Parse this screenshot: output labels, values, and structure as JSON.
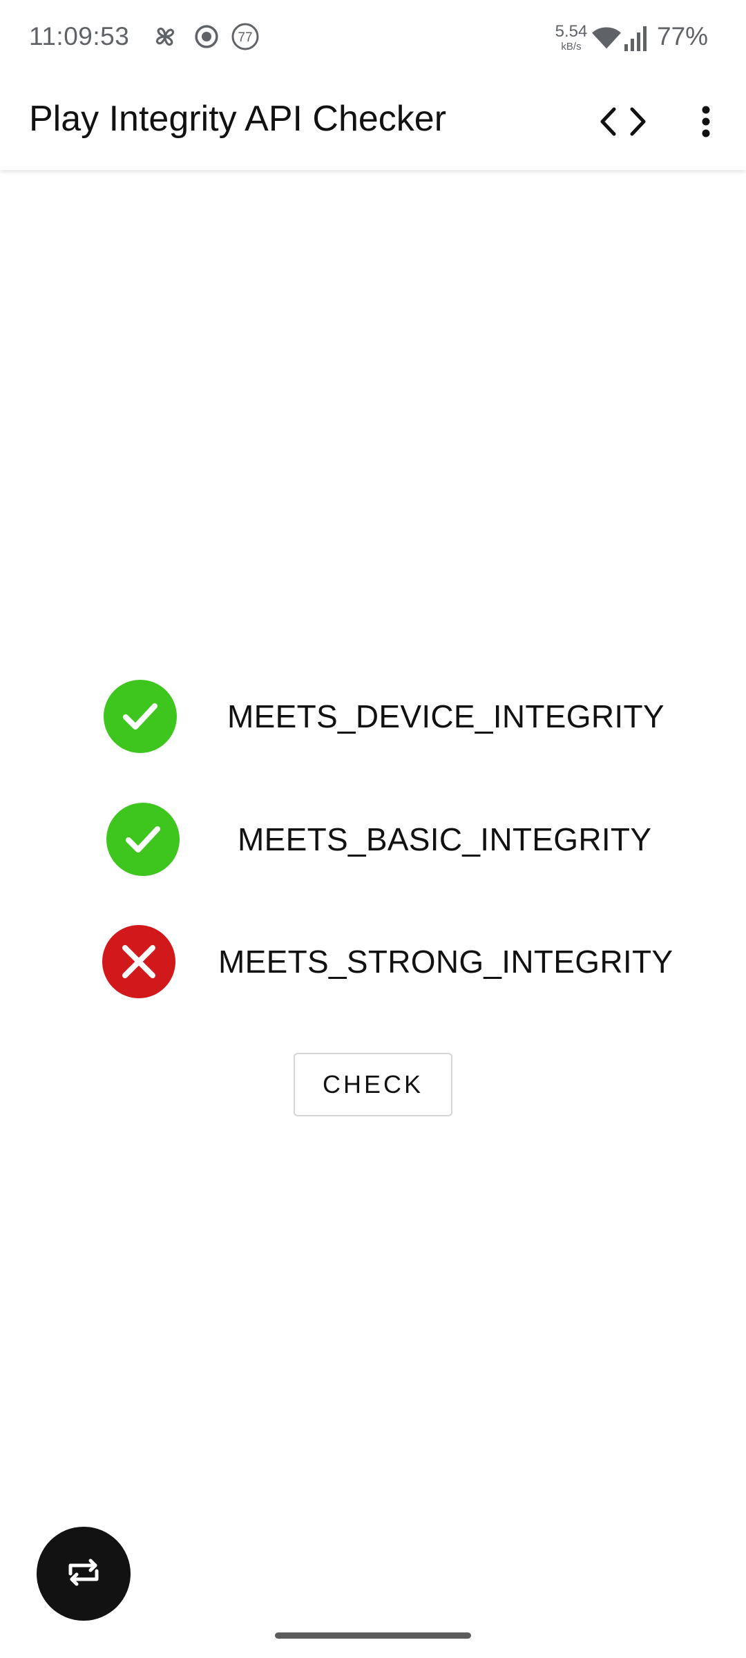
{
  "status_bar": {
    "time": "11:09:53",
    "notification_icons": [
      "pinwheel-icon",
      "record-icon",
      "badge-77-icon"
    ],
    "badge_count": "77",
    "net_speed_value": "5.54",
    "net_speed_unit": "kB/s",
    "battery": "77%"
  },
  "app_bar": {
    "title": "Play Integrity API Checker",
    "actions": [
      "code-icon",
      "more-vert-icon"
    ]
  },
  "results": [
    {
      "label": "MEETS_DEVICE_INTEGRITY",
      "status": "pass",
      "color": "#3ec61f"
    },
    {
      "label": "MEETS_BASIC_INTEGRITY",
      "status": "pass",
      "color": "#3ec61f"
    },
    {
      "label": "MEETS_STRONG_INTEGRITY",
      "status": "fail",
      "color": "#d1191c"
    }
  ],
  "check_button": {
    "label": "CHECK"
  },
  "fab": {
    "icon": "repeat-icon",
    "color": "#121212"
  }
}
